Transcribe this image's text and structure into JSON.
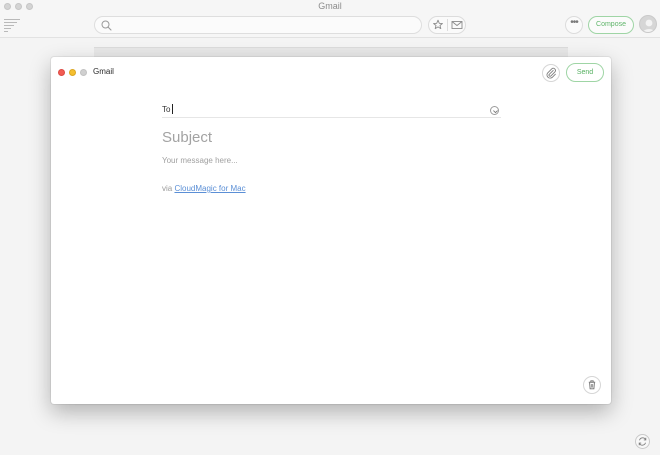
{
  "window": {
    "title": "Gmail"
  },
  "toolbar": {
    "search_value": "",
    "search_placeholder": "",
    "compose_label": "Compose",
    "more_label": "•••",
    "icons": {
      "menu": "menu-lines-icon",
      "search": "search-icon",
      "star": "star-icon",
      "mail": "mail-icon",
      "avatar": "user-avatar-icon",
      "refresh": "refresh-icon"
    }
  },
  "compose": {
    "account_label": "Gmail",
    "send_label": "Send",
    "to_label": "To",
    "to_value": "",
    "subject_placeholder": "Subject",
    "message_placeholder": "Your message here...",
    "signature_prefix": "via ",
    "signature_link": "CloudMagic for Mac",
    "icons": {
      "attach": "paperclip-icon",
      "expand": "chevron-down-icon",
      "trash": "trash-icon"
    }
  },
  "colors": {
    "accent_green": "#5fb56a",
    "link_blue": "#5b8fd6",
    "close_red": "#f25c54",
    "minimize_yellow": "#f5bf2f",
    "zoom_gray": "#d0d0d0"
  }
}
